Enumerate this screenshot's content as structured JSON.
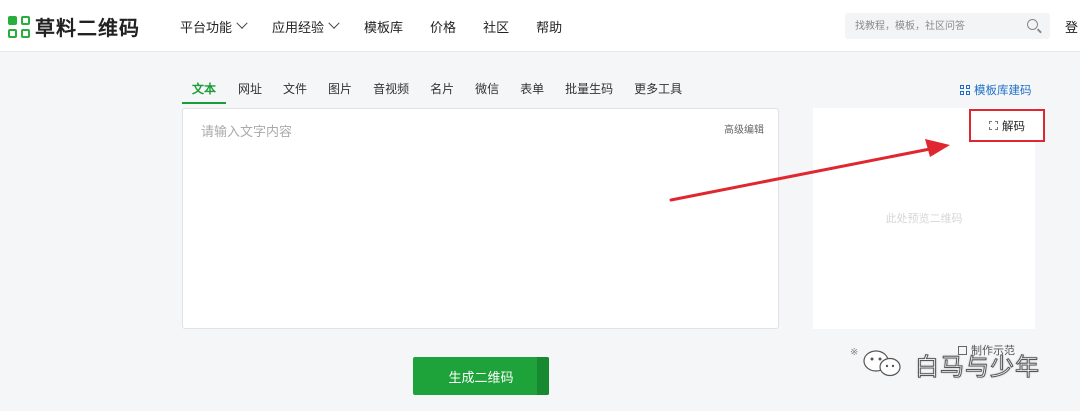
{
  "header": {
    "brand": "草料二维码",
    "nav": [
      {
        "label": "平台功能",
        "dropdown": true
      },
      {
        "label": "应用经验",
        "dropdown": true
      },
      {
        "label": "模板库",
        "dropdown": false
      },
      {
        "label": "价格",
        "dropdown": false
      },
      {
        "label": "社区",
        "dropdown": false
      },
      {
        "label": "帮助",
        "dropdown": false
      }
    ],
    "search_placeholder": "找教程，模板，社区问答",
    "login_label": "登"
  },
  "tabs": [
    "文本",
    "网址",
    "文件",
    "图片",
    "音视频",
    "名片",
    "微信",
    "表单",
    "批量生码",
    "更多工具"
  ],
  "active_tab": "文本",
  "template_link": "模板库建码",
  "editor": {
    "placeholder": "请输入文字内容",
    "advanced_edit": "高级编辑"
  },
  "preview": {
    "placeholder": "此处预览二维码",
    "decode_label": "解码",
    "make_tip": "制作示范"
  },
  "generate_button": "生成二维码",
  "watermark": "白马与少年",
  "colors": {
    "brand_green": "#1ea33b",
    "link_blue": "#1b6fc7",
    "highlight_red": "#e0262e"
  },
  "icons": [
    "logo-icon",
    "chevron-down-icon",
    "search-icon",
    "qr-code-icon",
    "scan-icon",
    "wechat-icon"
  ]
}
